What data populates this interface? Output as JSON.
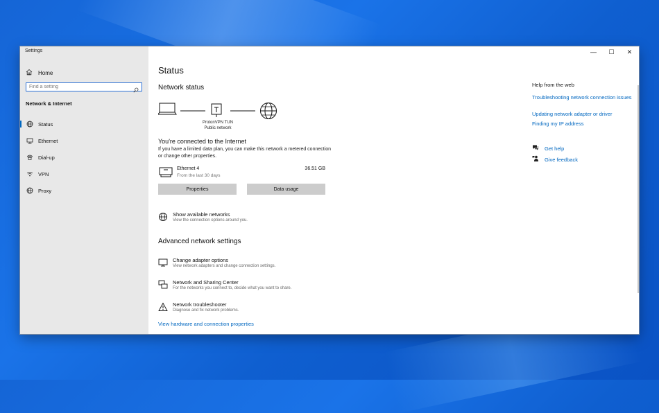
{
  "window": {
    "title": "Settings",
    "controls": {
      "minimize": "—",
      "maximize": "☐",
      "close": "✕"
    }
  },
  "sidebar": {
    "home_label": "Home",
    "search_placeholder": "Find a setting",
    "section_title": "Network & Internet",
    "items": [
      {
        "label": "Status",
        "icon": "globe-status-icon",
        "active": true
      },
      {
        "label": "Ethernet",
        "icon": "ethernet-icon",
        "active": false
      },
      {
        "label": "Dial-up",
        "icon": "phone-icon",
        "active": false
      },
      {
        "label": "VPN",
        "icon": "vpn-icon",
        "active": false
      },
      {
        "label": "Proxy",
        "icon": "globe-icon",
        "active": false
      }
    ]
  },
  "main": {
    "page_title": "Status",
    "network_status_heading": "Network status",
    "diagram": {
      "vpn_name": "ProtonVPN TUN",
      "network_type": "Public network"
    },
    "connected_title": "You're connected to the Internet",
    "connected_desc": "If you have a limited data plan, you can make this network a metered connection or change other properties.",
    "adapter": {
      "name": "Ethernet 4",
      "period": "From the last 30 days",
      "usage": "36.51 GB"
    },
    "buttons": {
      "properties": "Properties",
      "data_usage": "Data usage"
    },
    "show_networks": {
      "title": "Show available networks",
      "subtitle": "View the connection options around you."
    },
    "advanced_heading": "Advanced network settings",
    "advanced_items": [
      {
        "title": "Change adapter options",
        "subtitle": "View network adapters and change connection settings."
      },
      {
        "title": "Network and Sharing Center",
        "subtitle": "For the networks you connect to, decide what you want to share."
      },
      {
        "title": "Network troubleshooter",
        "subtitle": "Diagnose and fix network problems."
      }
    ],
    "hardware_link": "View hardware and connection properties"
  },
  "help": {
    "title": "Help from the web",
    "links": [
      "Troubleshooting network connection issues",
      "Updating network adapter or driver",
      "Finding my IP address"
    ],
    "get_help": "Get help",
    "give_feedback": "Give feedback"
  },
  "colors": {
    "accent": "#0067c0",
    "sidebar_bg": "#e8e8e8",
    "button_bg": "#cccccc",
    "desktop": "#1a73e8"
  }
}
